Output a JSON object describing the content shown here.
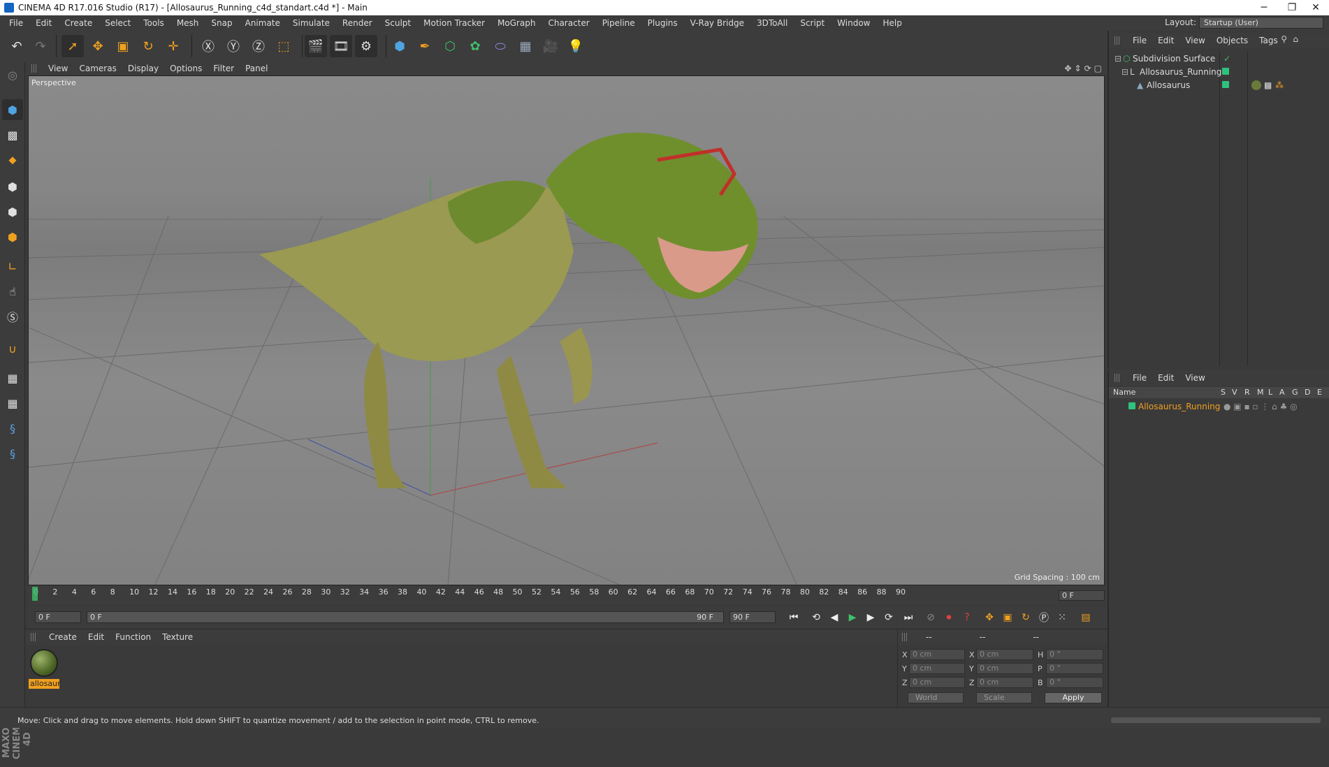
{
  "window": {
    "title": "CINEMA 4D R17.016 Studio (R17) - [Allosaurus_Running_c4d_standart.c4d *] - Main",
    "minimize": "─",
    "restore": "❐",
    "close": "✕"
  },
  "menubar": {
    "items": [
      "File",
      "Edit",
      "Create",
      "Select",
      "Tools",
      "Mesh",
      "Snap",
      "Animate",
      "Simulate",
      "Render",
      "Sculpt",
      "Motion Tracker",
      "MoGraph",
      "Character",
      "Pipeline",
      "Plugins",
      "V-Ray Bridge",
      "3DToAll",
      "Script",
      "Window",
      "Help"
    ],
    "layout_label": "Layout:",
    "layout_value": "Startup (User)"
  },
  "viewport": {
    "menu": [
      "View",
      "Cameras",
      "Display",
      "Options",
      "Filter",
      "Panel"
    ],
    "camera": "Perspective",
    "grid_spacing": "Grid Spacing : 100 cm"
  },
  "object_manager": {
    "menu": [
      "File",
      "Edit",
      "View",
      "Objects",
      "Tags"
    ],
    "objects": [
      "Subdivision Surface",
      "Allosaurus_Running",
      "Allosaurus"
    ]
  },
  "attribute_manager": {
    "menu": [
      "File",
      "Edit",
      "View"
    ],
    "headers": [
      "Name",
      "S",
      "V",
      "R",
      "M",
      "L",
      "A",
      "G",
      "D",
      "E"
    ],
    "row_name": "Allosaurus_Running"
  },
  "timeline": {
    "ticks": [
      "0",
      "2",
      "4",
      "6",
      "8",
      "10",
      "12",
      "14",
      "16",
      "18",
      "20",
      "22",
      "24",
      "26",
      "28",
      "30",
      "32",
      "34",
      "36",
      "38",
      "40",
      "42",
      "44",
      "46",
      "48",
      "50",
      "52",
      "54",
      "56",
      "58",
      "60",
      "62",
      "64",
      "66",
      "68",
      "70",
      "72",
      "74",
      "76",
      "78",
      "80",
      "82",
      "84",
      "86",
      "88",
      "90"
    ],
    "current_frame_box": "0 F"
  },
  "playbar": {
    "start": "0 F",
    "range_left": "0 F",
    "range_right": "90 F",
    "end": "90 F"
  },
  "material_manager": {
    "menu": [
      "Create",
      "Edit",
      "Function",
      "Texture"
    ],
    "material_name": "allosaur"
  },
  "coords": {
    "labels_pos": [
      "X",
      "Y",
      "Z"
    ],
    "labels_size": [
      "X",
      "Y",
      "Z"
    ],
    "labels_rot": [
      "H",
      "P",
      "B"
    ],
    "pos": [
      "0 cm",
      "0 cm",
      "0 cm"
    ],
    "size": [
      "0 cm",
      "0 cm",
      "0 cm"
    ],
    "rot": [
      "0 °",
      "0 °",
      "0 °"
    ],
    "head": [
      "--",
      "--",
      "--"
    ],
    "world": "World",
    "scale": "Scale",
    "apply": "Apply"
  },
  "status": {
    "text": "Move: Click and drag to move elements. Hold down SHIFT to quantize movement / add to the selection in point mode, CTRL to remove."
  },
  "brand": "MAXON CINEMA 4D",
  "colors": {
    "accent": "#f0a020",
    "green_dot": "#2ec27e",
    "bg": "#3a3a3a"
  }
}
